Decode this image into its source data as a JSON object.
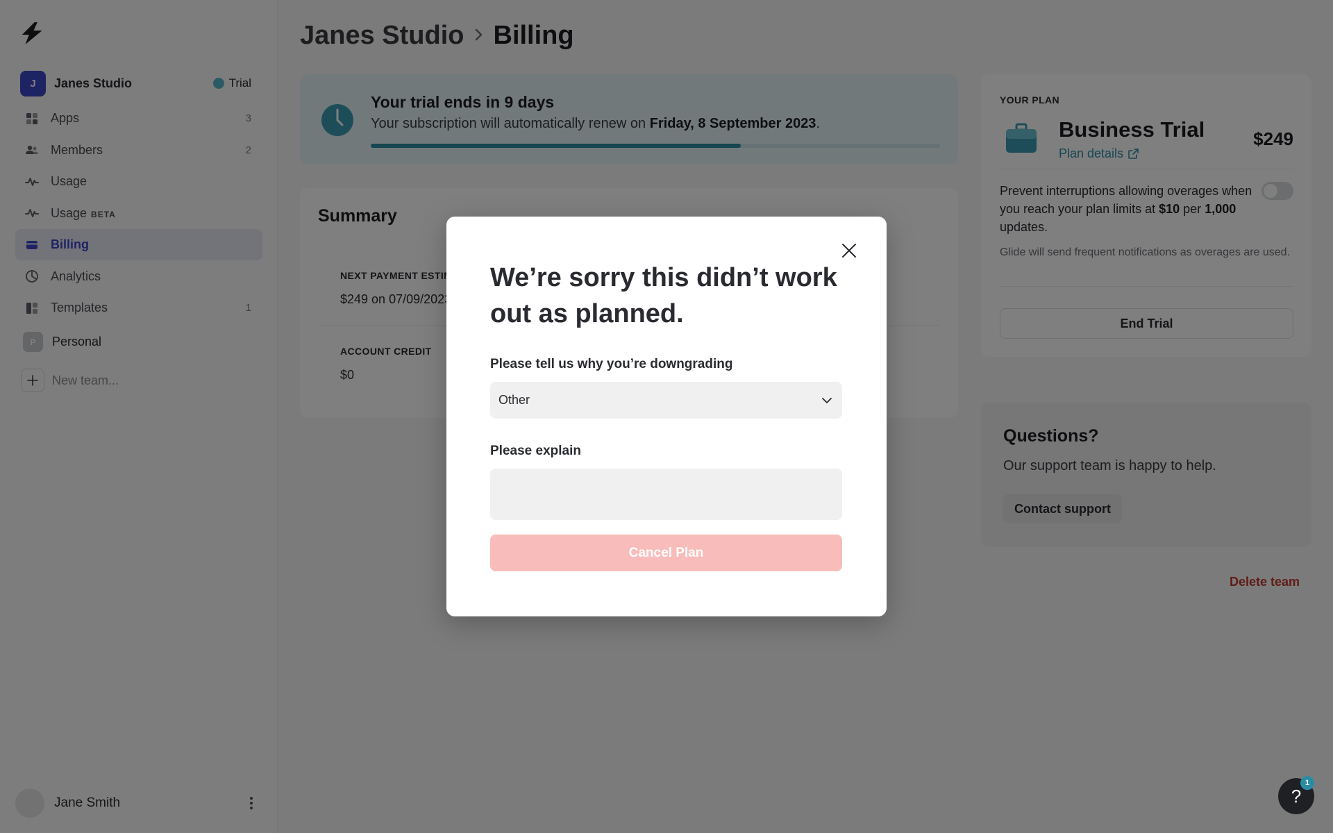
{
  "sidebar": {
    "team": {
      "initial": "J",
      "name": "Janes Studio",
      "badge": "Trial"
    },
    "nav": [
      {
        "label": "Apps",
        "count": "3",
        "icon": "apps-icon"
      },
      {
        "label": "Members",
        "count": "2",
        "icon": "members-icon"
      },
      {
        "label": "Usage",
        "count": "",
        "icon": "usage-icon"
      },
      {
        "label": "Usage",
        "beta": "BETA",
        "count": "",
        "icon": "usage-icon"
      },
      {
        "label": "Billing",
        "count": "",
        "icon": "billing-icon",
        "active": true
      },
      {
        "label": "Analytics",
        "count": "",
        "icon": "analytics-icon"
      },
      {
        "label": "Templates",
        "count": "1",
        "icon": "templates-icon"
      }
    ],
    "personal": {
      "initial": "P",
      "label": "Personal"
    },
    "new_team": "New team...",
    "user": {
      "name": "Jane Smith"
    }
  },
  "breadcrumb": {
    "team": "Janes Studio",
    "page": "Billing"
  },
  "trial_banner": {
    "title": "Your trial ends in 9 days",
    "sub_prefix": "Your subscription will automatically renew on ",
    "renew_date": "Friday, 8 September 2023",
    "sub_suffix": ".",
    "progress": 0.65
  },
  "summary": {
    "title": "Summary",
    "next_payment_label": "NEXT PAYMENT ESTIMATE",
    "next_payment_value": "$249 on 07/09/2023",
    "credit_label": "ACCOUNT CREDIT",
    "credit_value": "$0"
  },
  "plan": {
    "eyebrow": "YOUR PLAN",
    "name": "Business Trial",
    "details_link": "Plan details",
    "price": "$249",
    "overage_p1": "Prevent interruptions allowing overages when you reach your plan limits at ",
    "overage_amount": "$10",
    "overage_p2": " per ",
    "overage_units": "1,000",
    "overage_p3": " updates.",
    "overage_note": "Glide will send frequent notifications as overages are used.",
    "end_trial": "End Trial"
  },
  "questions": {
    "title": "Questions?",
    "sub": "Our support team is happy to help.",
    "contact": "Contact support"
  },
  "delete_team": "Delete team",
  "help": {
    "glyph": "?",
    "badge": "1"
  },
  "modal": {
    "title": "We’re sorry this didn’t work out as planned.",
    "reason_label": "Please tell us why you’re downgrading",
    "reason_value": "Other",
    "explain_label": "Please explain",
    "explain_value": "",
    "cancel_plan": "Cancel Plan"
  },
  "colors": {
    "accent": "#3d46c7",
    "teal": "#2a8ca4",
    "danger": "#c0392b",
    "cancel_disabled": "#f8bcba"
  }
}
